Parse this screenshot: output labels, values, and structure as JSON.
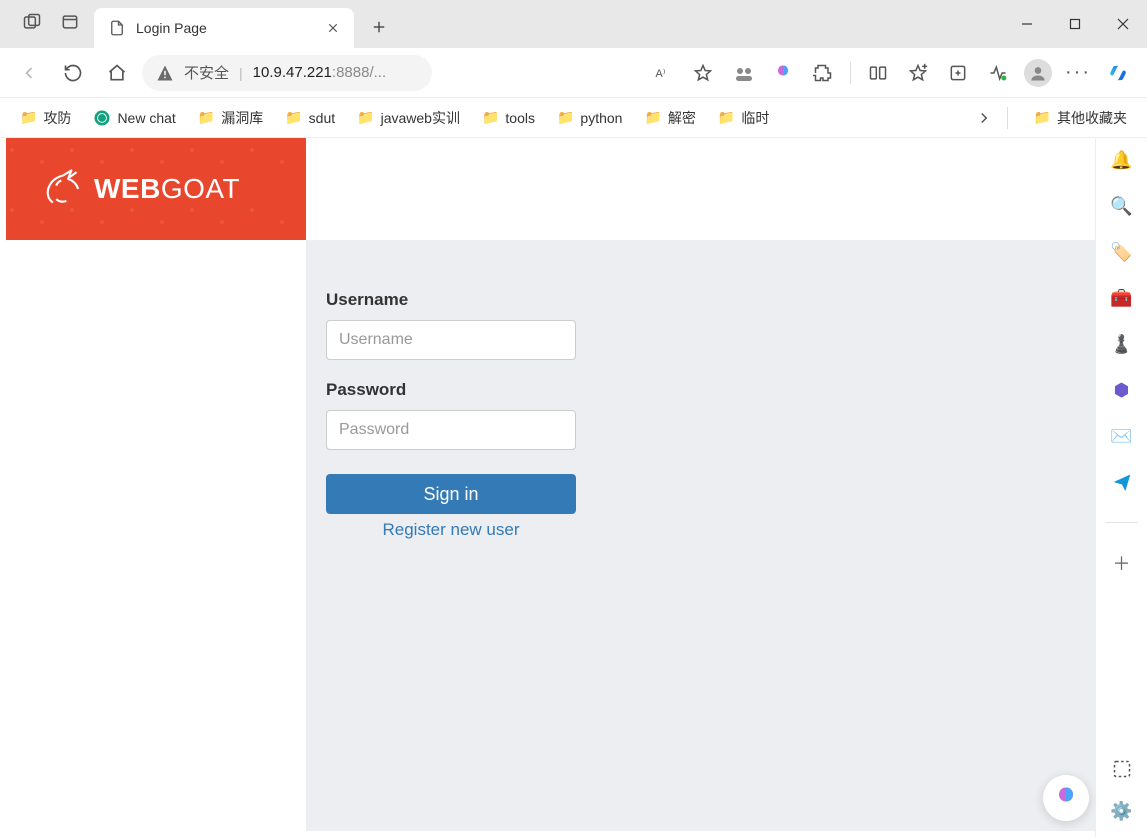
{
  "window": {
    "tab_title": "Login Page"
  },
  "addr": {
    "security_text": "不安全",
    "host": "10.9.47.221",
    "port_path": ":8888/..."
  },
  "bookmarks": {
    "items": [
      {
        "label": "攻防"
      },
      {
        "label": "New chat",
        "icon": "openai"
      },
      {
        "label": "漏洞库"
      },
      {
        "label": "sdut"
      },
      {
        "label": "javaweb实训"
      },
      {
        "label": "tools"
      },
      {
        "label": "python"
      },
      {
        "label": "解密"
      },
      {
        "label": "临时"
      }
    ],
    "overflow_label": "其他收藏夹"
  },
  "brand": {
    "bold": "WEB",
    "rest": "GOAT"
  },
  "form": {
    "username_label": "Username",
    "username_placeholder": "Username",
    "password_label": "Password",
    "password_placeholder": "Password",
    "signin_label": "Sign in",
    "register_label": "Register new user"
  }
}
